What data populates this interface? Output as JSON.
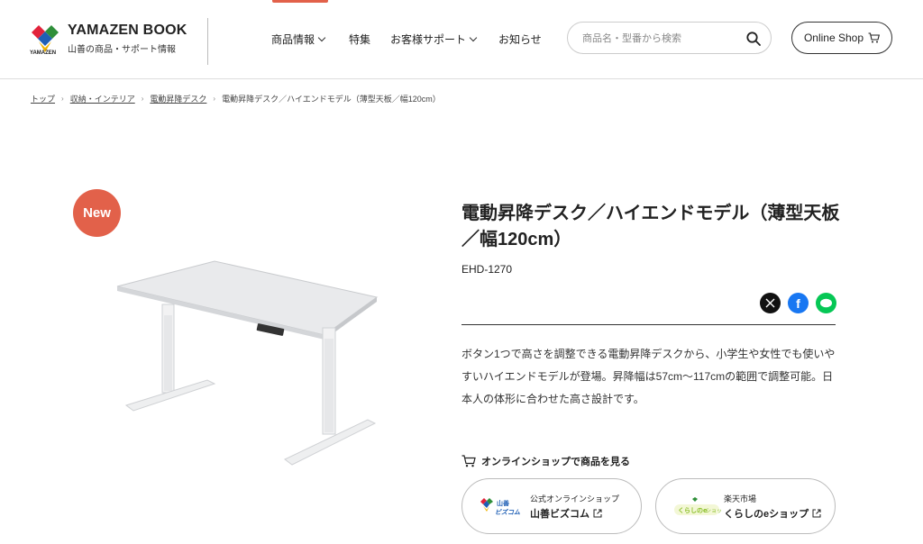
{
  "header": {
    "logo_title": "YAMAZEN BOOK",
    "logo_sub": "山善の商品・サポート情報",
    "logo_small": "YAMAZEN",
    "nav": [
      {
        "label": "商品情報",
        "has_menu": true
      },
      {
        "label": "特集",
        "has_menu": false
      },
      {
        "label": "お客様サポート",
        "has_menu": true
      },
      {
        "label": "お知らせ",
        "has_menu": false
      }
    ],
    "search_placeholder": "商品名・型番から検索",
    "online_shop": "Online Shop",
    "accent_color": "#e2614a"
  },
  "breadcrumb": {
    "items": [
      "トップ",
      "収納・インテリア",
      "電動昇降デスク"
    ],
    "current": "電動昇降デスク／ハイエンドモデル（薄型天板／幅120cm）"
  },
  "product": {
    "badge": "New",
    "title": "電動昇降デスク／ハイエンドモデル（薄型天板／幅120cm）",
    "code": "EHD-1270",
    "share_icons": [
      "x-icon",
      "facebook-icon",
      "line-icon"
    ],
    "description": "ボタン1つで高さを調整できる電動昇降デスクから、小学生や女性でも使いやすいハイエンドモデルが登場。昇降幅は57cm〜117cmの範囲で調整可能。日本人の体形に合わせた高さ設計です。"
  },
  "shops": {
    "heading": "オンラインショップで商品を見る",
    "cards": [
      {
        "small": "公式オンラインショップ",
        "name": "山善ビズコム",
        "logo_text": "山善ビズコム"
      },
      {
        "small": "楽天市場",
        "name": "くらしのeショップ",
        "logo_text": "くらしのeショップ"
      }
    ]
  }
}
